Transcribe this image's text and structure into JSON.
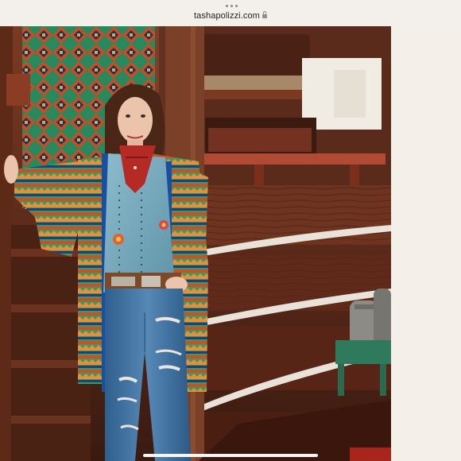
{
  "browser": {
    "url": "tashapolizzi.com"
  },
  "photo": {
    "alt": "",
    "colors": {
      "wood_dark": "#3d1d12",
      "wood_mid": "#6e3420",
      "wood_light": "#9a5636",
      "chinking": "#e8e2d8",
      "denim": "#3f6f9e",
      "shirt": "#7fb0c2",
      "bandana": "#b52a24",
      "blanket_green": "#2f9d6a",
      "blanket_orange": "#e2582a",
      "blanket_navy": "#1d3a6b"
    }
  }
}
